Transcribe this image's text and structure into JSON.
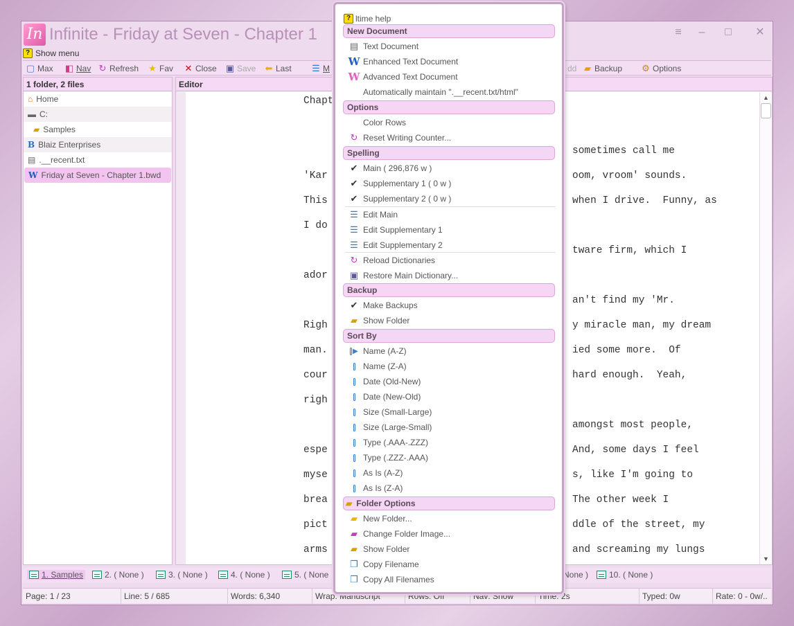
{
  "window": {
    "title": "Infinite - Friday at Seven - Chapter 1",
    "logo_text": "In",
    "controls": [
      "≡",
      "–",
      "□",
      "✕"
    ]
  },
  "showmenu": {
    "label": "Show menu"
  },
  "toolbar": {
    "max": "Max",
    "nav": "Nav",
    "refresh": "Refresh",
    "fav": "Fav",
    "close": "Close",
    "save": "Save",
    "last": "Last",
    "m": "M",
    "add": "dd",
    "backup": "Backup",
    "options": "Options"
  },
  "leftpane": {
    "header": "1 folder, 2 files",
    "items": [
      "Home",
      "C:",
      "Samples",
      "Blaiz Enterprises",
      ".__recent.txt",
      "Friday at Seven - Chapter 1.bwd"
    ]
  },
  "editor": {
    "header": "Editor",
    "lines": [
      {
        "left": "Chapt",
        "right": ""
      },
      {
        "left": "",
        "right": "sometimes call me"
      },
      {
        "left": "'Kar",
        "right": "oom, vroom' sounds."
      },
      {
        "left": "This",
        "right": "when I drive.  Funny, as"
      },
      {
        "left": "I do",
        "right": ""
      },
      {
        "left": "",
        "right": "tware firm, which I"
      },
      {
        "left": "ador",
        "right": ""
      },
      {
        "left": "",
        "right": "an't find my 'Mr."
      },
      {
        "left": "Righ",
        "right": "y miracle man, my dream"
      },
      {
        "left": "man.",
        "right": "ied some more.  Of"
      },
      {
        "left": "cour",
        "right": "hard enough.  Yeah,"
      },
      {
        "left": "righ",
        "right": ""
      },
      {
        "left": "",
        "right": "amongst most people,"
      },
      {
        "left": "espe",
        "right": "And, some days I feel"
      },
      {
        "left": "myse",
        "right": "s, like I'm going to"
      },
      {
        "left": "brea",
        "right": "The other week I"
      },
      {
        "left": "pict",
        "right": "ddle of the street, my"
      },
      {
        "left": "arms",
        "right": "and screaming my lungs"
      }
    ]
  },
  "tabs": [
    "1. Samples",
    "2. ( None )",
    "3. ( None )",
    "4. ( None )",
    "5. ( None",
    "None )",
    "10. ( None )"
  ],
  "status": {
    "page": "Page: 1 / 23",
    "line": "Line: 5 / 685",
    "words": "Words: 6,340",
    "wrap": "Wrap: Manuscript",
    "rows": "Rows: Off",
    "nav": "Nav: Show",
    "time": "Time: 2s",
    "typed": "Typed: 0w",
    "rate": "Rate: 0 - 0w/.."
  },
  "menu": {
    "help": "ltime help",
    "h_new": "New Document",
    "text_doc": "Text Document",
    "enh_doc": "Enhanced Text Document",
    "adv_doc": "Advanced Text Document",
    "auto_recent": "Automatically maintain \".__recent.txt/html\"",
    "h_options": "Options",
    "color_rows": "Color Rows",
    "reset_counter": "Reset Writing Counter...",
    "h_spelling": "Spelling",
    "main": "Main  ( 296,876 w )",
    "supp1": "Supplementary 1  ( 0 w )",
    "supp2": "Supplementary 2  ( 0 w )",
    "edit_main": "Edit Main",
    "edit_supp1": "Edit Supplementary 1",
    "edit_supp2": "Edit Supplementary 2",
    "reload_dicts": "Reload Dictionaries",
    "restore_main": "Restore Main Dictionary...",
    "h_backup": "Backup",
    "make_backups": "Make Backups",
    "show_folder_b": "Show Folder",
    "h_sort": "Sort By",
    "sort_name_az": "Name (A-Z)",
    "sort_name_za": "Name (Z-A)",
    "sort_date_on": "Date (Old-New)",
    "sort_date_no": "Date (New-Old)",
    "sort_size_sl": "Size (Small-Large)",
    "sort_size_ls": "Size (Large-Small)",
    "sort_type_az": "Type (.AAA-.ZZZ)",
    "sort_type_za": "Type (.ZZZ-.AAA)",
    "sort_asis_az": "As Is (A-Z)",
    "sort_asis_za": "As Is (Z-A)",
    "h_folder": "Folder Options",
    "new_folder": "New Folder...",
    "change_image": "Change Folder Image...",
    "show_folder_f": "Show Folder",
    "copy_filename": "Copy Filename",
    "copy_all": "Copy All Filenames"
  }
}
